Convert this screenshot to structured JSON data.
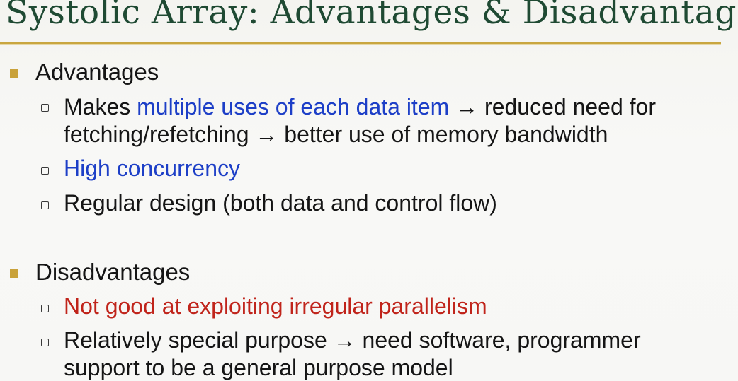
{
  "slide": {
    "title": "Systolic Array: Advantages & Disadvantages",
    "sections": [
      {
        "heading": "Advantages",
        "items": [
          {
            "line1_highlight_pre": "Makes ",
            "line1_highlight": "multiple uses of each data item",
            "line1_post": " → reduced need for",
            "line2": "fetching/refetching → better use of memory bandwidth"
          },
          {
            "text": "High concurrency"
          },
          {
            "text": "Regular design (both data and control flow)"
          }
        ]
      },
      {
        "heading": "Disadvantages",
        "items": [
          {
            "text": "Not good at exploiting irregular parallelism"
          },
          {
            "line1": "Relatively special purpose → need software, programmer",
            "line2": "support to be a general purpose model"
          }
        ]
      }
    ],
    "colors": {
      "title": "#1f4a33",
      "rule": "#c9a640",
      "bullet_l1": "#c9a23a",
      "highlight_blue": "#1d3fc7",
      "highlight_red": "#c0241b",
      "text": "#151515"
    }
  }
}
